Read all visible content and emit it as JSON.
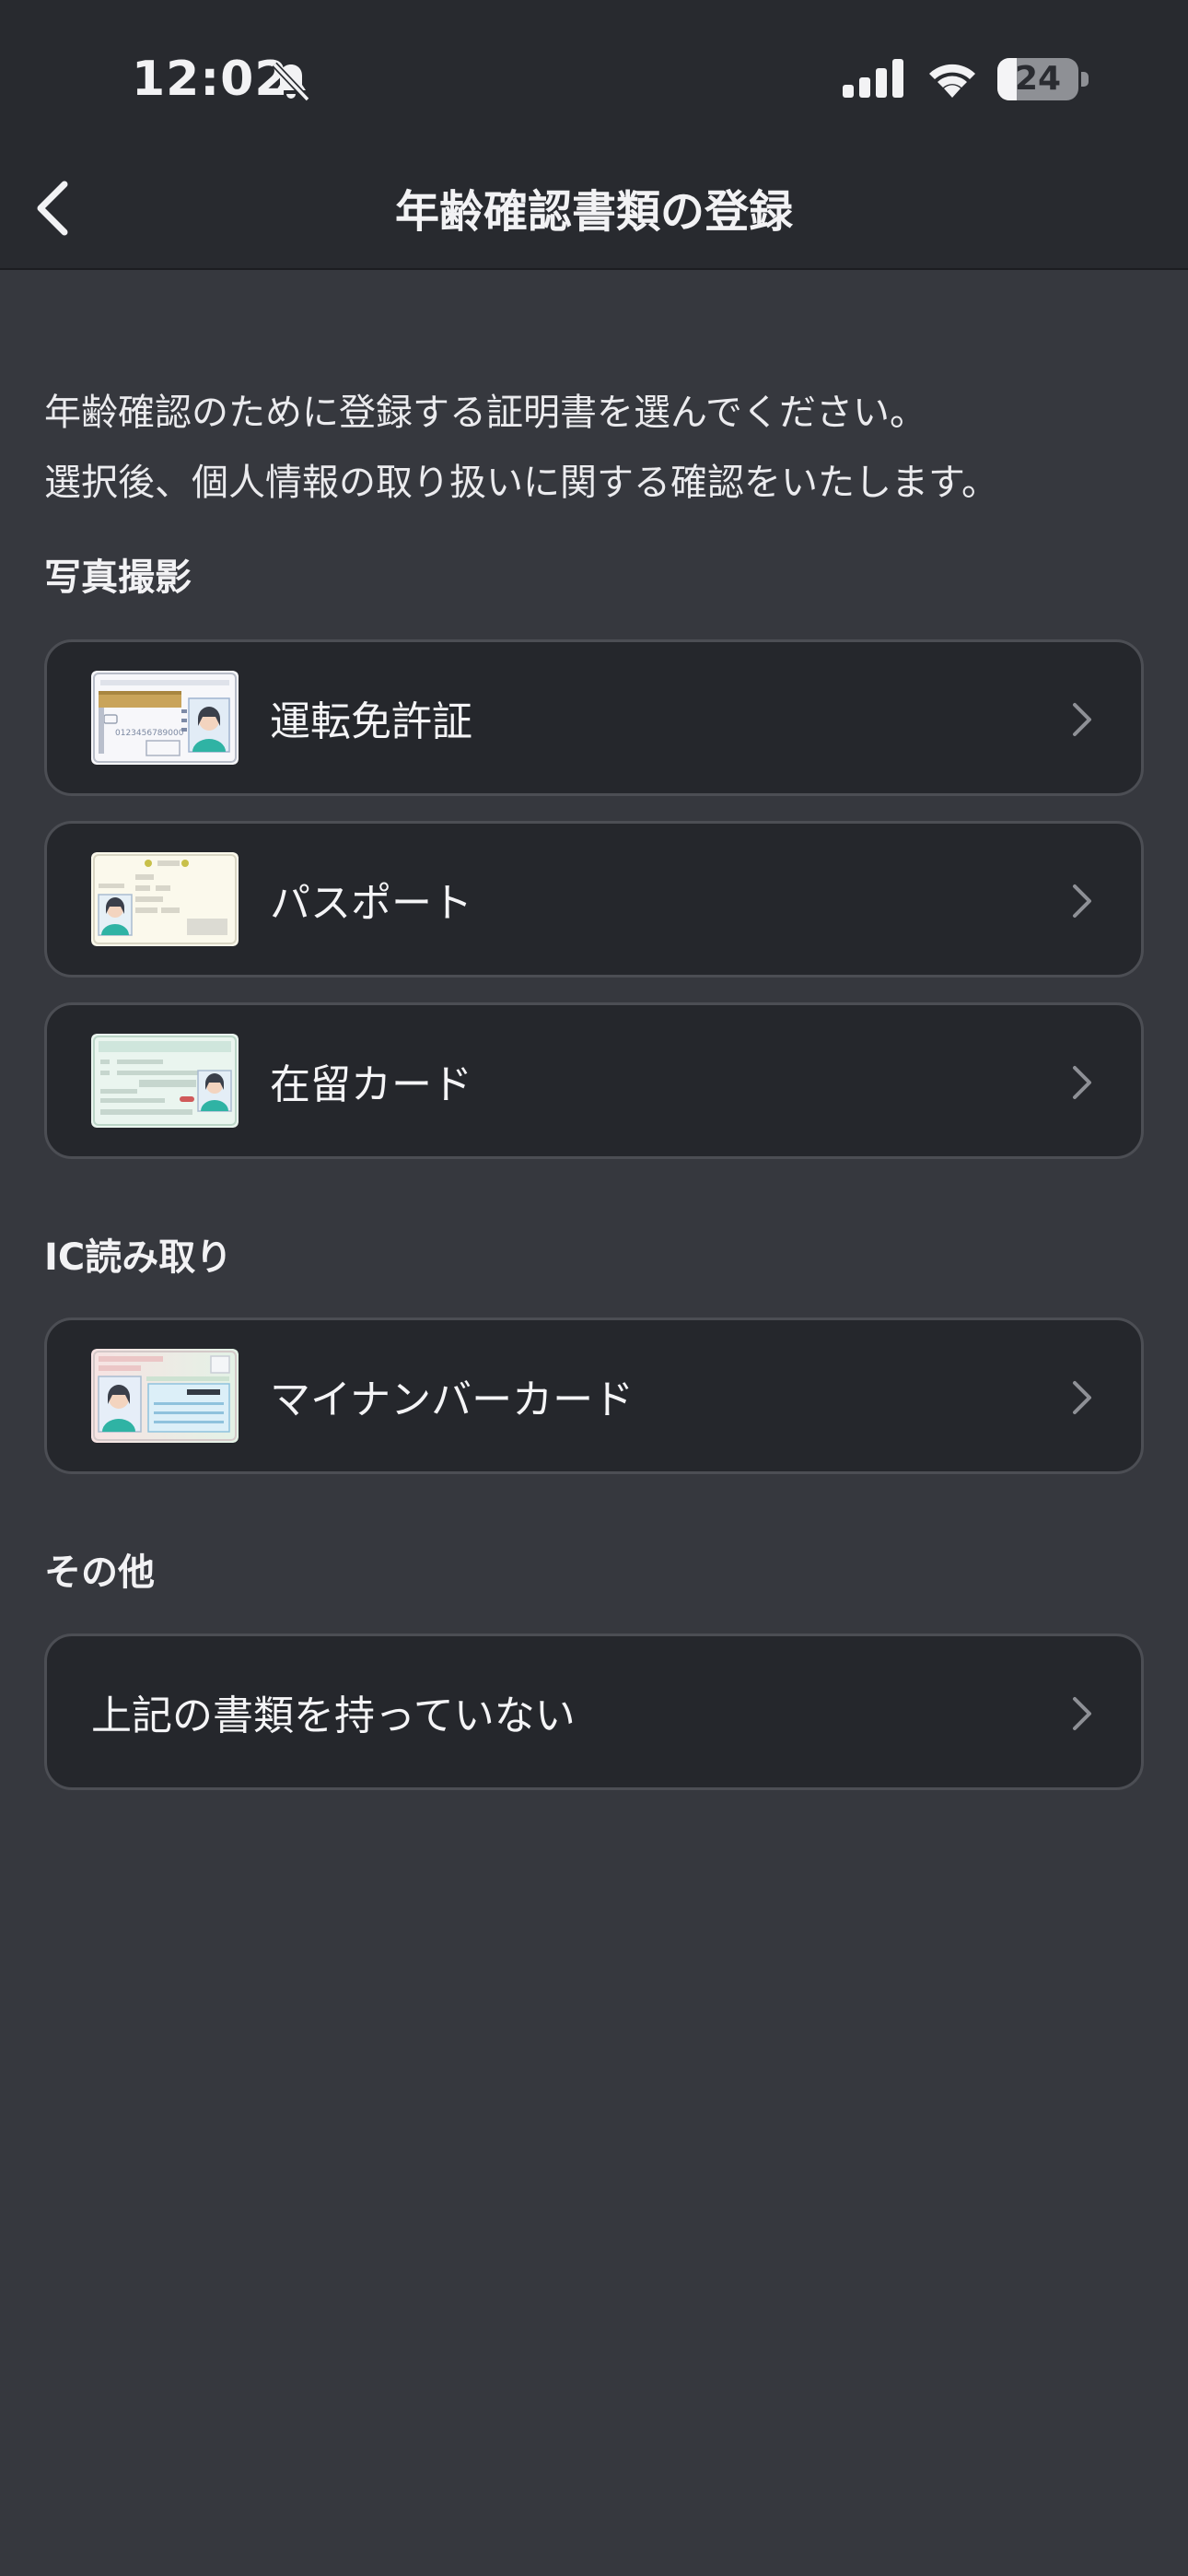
{
  "status_bar": {
    "time": "12:02",
    "battery_percent": "24",
    "icons": [
      "bell-off-icon",
      "signal-icon",
      "wifi-icon",
      "battery-icon"
    ]
  },
  "nav": {
    "title": "年齢確認書類の登録",
    "back_icon": "chevron-left-icon"
  },
  "intro": {
    "line1": "年齢確認のために登録する証明書を選んでください。",
    "line2": "選択後、個人情報の取り扱いに関する確認をいたします。"
  },
  "sections": {
    "photo": {
      "heading": "写真撮影",
      "items": [
        {
          "label": "運転免許証",
          "thumb_icon": "drivers-license-icon"
        },
        {
          "label": "パスポート",
          "thumb_icon": "passport-icon"
        },
        {
          "label": "在留カード",
          "thumb_icon": "residence-card-icon"
        }
      ]
    },
    "ic": {
      "heading": "IC読み取り",
      "items": [
        {
          "label": "マイナンバーカード",
          "thumb_icon": "my-number-card-icon"
        }
      ]
    },
    "other": {
      "heading": "その他",
      "items": [
        {
          "label": "上記の書類を持っていない"
        }
      ]
    }
  },
  "license_number": "0123456789000",
  "colors": {
    "background": "#36383e",
    "topbar": "#282a2f",
    "card": "#25272c",
    "card_border": "#4c4e54",
    "text": "#f2f2f4"
  }
}
